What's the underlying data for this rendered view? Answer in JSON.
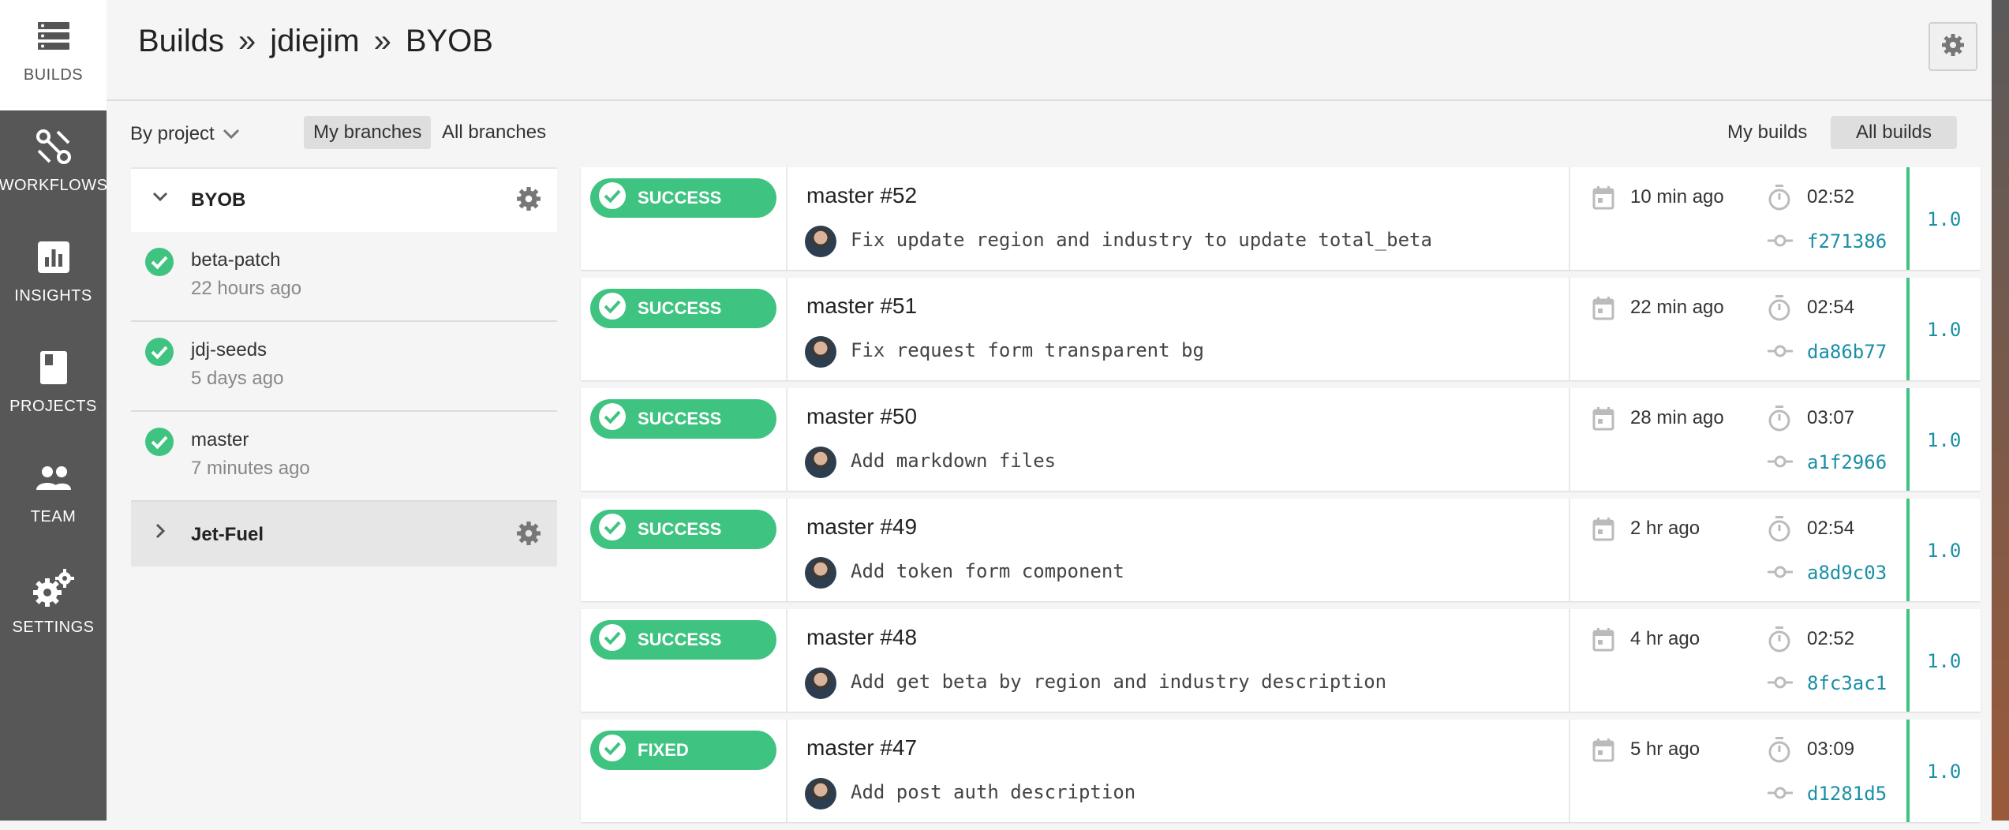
{
  "colors": {
    "success": "#3fc380",
    "link": "#1a8fa6",
    "rail": "#575757"
  },
  "nav": [
    {
      "label": "BUILDS",
      "icon": "builds-icon"
    },
    {
      "label": "WORKFLOWS",
      "icon": "workflows-icon"
    },
    {
      "label": "INSIGHTS",
      "icon": "insights-icon"
    },
    {
      "label": "PROJECTS",
      "icon": "projects-icon"
    },
    {
      "label": "TEAM",
      "icon": "team-icon"
    },
    {
      "label": "SETTINGS",
      "icon": "settings-icon"
    }
  ],
  "breadcrumb": {
    "root": "Builds",
    "sep": "»",
    "org": "jdiejim",
    "project": "BYOB"
  },
  "filters": {
    "by_project": "By project",
    "my_branches": "My branches",
    "all_branches": "All branches",
    "my_builds": "My builds",
    "all_builds": "All builds"
  },
  "projects": [
    {
      "name": "BYOB",
      "branches": [
        {
          "name": "beta-patch",
          "time": "22 hours ago"
        },
        {
          "name": "jdj-seeds",
          "time": "5 days ago"
        },
        {
          "name": "master",
          "time": "7 minutes ago"
        }
      ]
    },
    {
      "name": "Jet-Fuel"
    }
  ],
  "builds": [
    {
      "status": "SUCCESS",
      "title": "master #52",
      "message": "Fix update region and industry to update total_beta",
      "when": "10 min ago",
      "duration": "02:52",
      "sha": "f271386",
      "version": "1.0"
    },
    {
      "status": "SUCCESS",
      "title": "master #51",
      "message": "Fix request form transparent bg",
      "when": "22 min ago",
      "duration": "02:54",
      "sha": "da86b77",
      "version": "1.0"
    },
    {
      "status": "SUCCESS",
      "title": "master #50",
      "message": "Add markdown files",
      "when": "28 min ago",
      "duration": "03:07",
      "sha": "a1f2966",
      "version": "1.0"
    },
    {
      "status": "SUCCESS",
      "title": "master #49",
      "message": "Add token form component",
      "when": "2 hr ago",
      "duration": "02:54",
      "sha": "a8d9c03",
      "version": "1.0"
    },
    {
      "status": "SUCCESS",
      "title": "master #48",
      "message": "Add get beta by region and industry description",
      "when": "4 hr ago",
      "duration": "02:52",
      "sha": "8fc3ac1",
      "version": "1.0"
    },
    {
      "status": "FIXED",
      "title": "master #47",
      "message": "Add post auth description",
      "when": "5 hr ago",
      "duration": "03:09",
      "sha": "d1281d5",
      "version": "1.0"
    }
  ]
}
